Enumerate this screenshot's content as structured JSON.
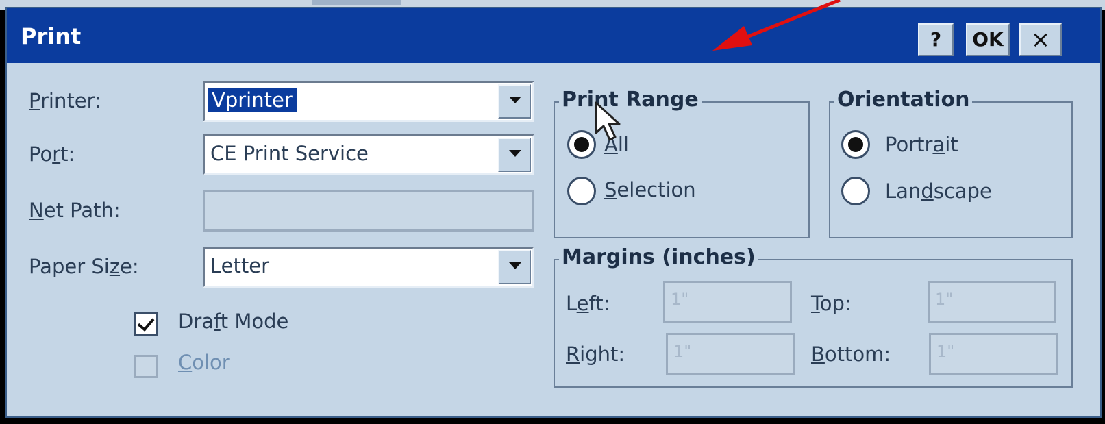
{
  "window": {
    "title": "Print"
  },
  "title_buttons": {
    "help": "?",
    "ok": "OK",
    "close": "×"
  },
  "fields": {
    "printer": {
      "label_pre": "",
      "label_u": "P",
      "label_post": "rinter:",
      "value": "Vprinter"
    },
    "port": {
      "label_pre": "Po",
      "label_u": "r",
      "label_post": "t:",
      "value": "CE Print Service"
    },
    "net_path": {
      "label_pre": "",
      "label_u": "N",
      "label_post": "et Path:",
      "value": ""
    },
    "paper_size": {
      "label_pre": "Paper Si",
      "label_u": "z",
      "label_post": "e:",
      "value": "Letter"
    }
  },
  "options": {
    "draft_mode": {
      "pre": "Dra",
      "u": "f",
      "post": "t Mode",
      "checked": true
    },
    "color": {
      "pre": "",
      "u": "C",
      "post": "olor",
      "checked": false
    }
  },
  "print_range": {
    "title": "Print Range",
    "all": {
      "pre": "",
      "u": "A",
      "post": "ll",
      "selected": true
    },
    "selection": {
      "pre": "",
      "u": "S",
      "post": "election",
      "selected": false
    }
  },
  "orientation": {
    "title": "Orientation",
    "portrait": {
      "pre": "Portr",
      "u": "a",
      "post": "it",
      "selected": true
    },
    "landscape": {
      "pre": "Lan",
      "u": "d",
      "post": "scape",
      "selected": false
    }
  },
  "margins": {
    "title": "Margins (inches)",
    "left": {
      "pre": "L",
      "u": "e",
      "post": "ft:",
      "value": "1\""
    },
    "top": {
      "pre": "",
      "u": "T",
      "post": "op:",
      "value": "1\""
    },
    "right": {
      "pre": "",
      "u": "R",
      "post": "ight:",
      "value": "1\""
    },
    "bottom": {
      "pre": "",
      "u": "B",
      "post": "ottom:",
      "value": "1\""
    }
  },
  "colors": {
    "titlebar": "#0b3c9e",
    "dialog_bg": "#c5d6e6",
    "annotation_arrow": "#e01010"
  }
}
